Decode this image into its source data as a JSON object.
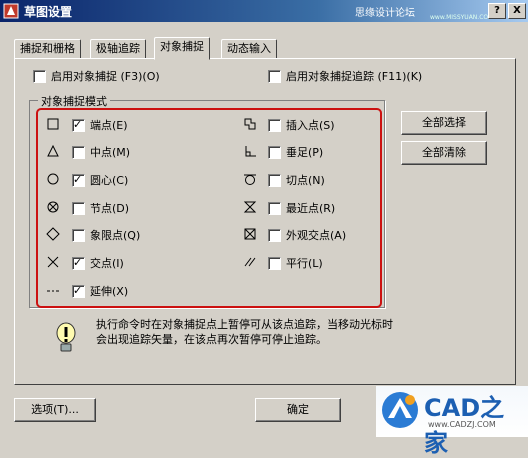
{
  "window": {
    "title": "草图设置",
    "watermark": "思缘设计论坛",
    "watermark_url": "www.MISSYUAN.COM",
    "help_label": "?",
    "close_label": "X"
  },
  "tabs": [
    {
      "label": "捕捉和栅格"
    },
    {
      "label": "极轴追踪"
    },
    {
      "label": "对象捕捉"
    },
    {
      "label": "动态输入"
    }
  ],
  "top_options": {
    "osnap_on": {
      "label": "启用对象捕捉 (F3)(O)",
      "checked": false
    },
    "otrack_on": {
      "label": "启用对象捕捉追踪 (F11)(K)",
      "checked": false
    }
  },
  "group": {
    "title": "对象捕捉模式"
  },
  "modes_left": [
    {
      "symbol": "square-icon",
      "label": "端点(E)",
      "checked": true
    },
    {
      "symbol": "triangle-icon",
      "label": "中点(M)",
      "checked": false
    },
    {
      "symbol": "circle-icon",
      "label": "圆心(C)",
      "checked": true
    },
    {
      "symbol": "node-icon",
      "label": "节点(D)",
      "checked": false
    },
    {
      "symbol": "diamond-icon",
      "label": "象限点(Q)",
      "checked": false
    },
    {
      "symbol": "cross-icon",
      "label": "交点(I)",
      "checked": true
    },
    {
      "symbol": "extension-icon",
      "label": "延伸(X)",
      "checked": true
    }
  ],
  "modes_right": [
    {
      "symbol": "insert-icon",
      "label": "插入点(S)",
      "checked": false
    },
    {
      "symbol": "perpendicular-icon",
      "label": "垂足(P)",
      "checked": false
    },
    {
      "symbol": "tangent-icon",
      "label": "切点(N)",
      "checked": false
    },
    {
      "symbol": "nearest-icon",
      "label": "最近点(R)",
      "checked": false
    },
    {
      "symbol": "apparent-intersection-icon",
      "label": "外观交点(A)",
      "checked": false
    },
    {
      "symbol": "parallel-icon",
      "label": "平行(L)",
      "checked": false
    }
  ],
  "buttons": {
    "select_all": "全部选择",
    "clear_all": "全部清除",
    "options": "选项(T)...",
    "ok": "确定"
  },
  "hint": {
    "line1": "执行命令时在对象捕捉点上暂停可从该点追踪，当移动光标时",
    "line2": "会出现追踪矢量，在该点再次暂停可停止追踪。"
  },
  "badge": {
    "text": "CAD之家",
    "url": "www.CADZJ.COM"
  }
}
